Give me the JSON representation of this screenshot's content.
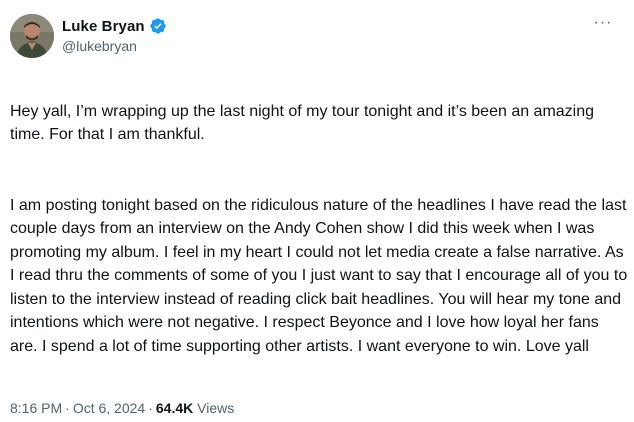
{
  "author": {
    "display_name": "Luke Bryan",
    "handle": "@lukebryan",
    "verified": true,
    "verified_color": "#1d9bf0",
    "avatar_icon": "profile-photo"
  },
  "more_label": "···",
  "tweet": {
    "paragraphs": [
      "Hey yall, I’m wrapping up the last night of my tour tonight and it’s been an amazing time. For that I am thankful.",
      "I am posting tonight based on the ridiculous nature of the headlines I have read the last couple days from an interview on the Andy Cohen show I did this week when I was promoting my album. I feel in my heart I could not let media create a false narrative. As I read thru the comments of some of you I just want to say that I encourage all of you to listen to the interview instead of reading click bait headlines. You will hear my tone and intentions which were not negative. I respect Beyonce and I love how loyal her fans are. I spend a lot of time supporting other artists. I want everyone to win. Love yall"
    ]
  },
  "meta": {
    "time": "8:16 PM",
    "separator": "·",
    "date": "Oct 6, 2024",
    "views_count": "64.4K",
    "views_label": "Views"
  },
  "colors": {
    "text": "#0f1419",
    "secondary": "#536471",
    "background": "#ffffff"
  }
}
